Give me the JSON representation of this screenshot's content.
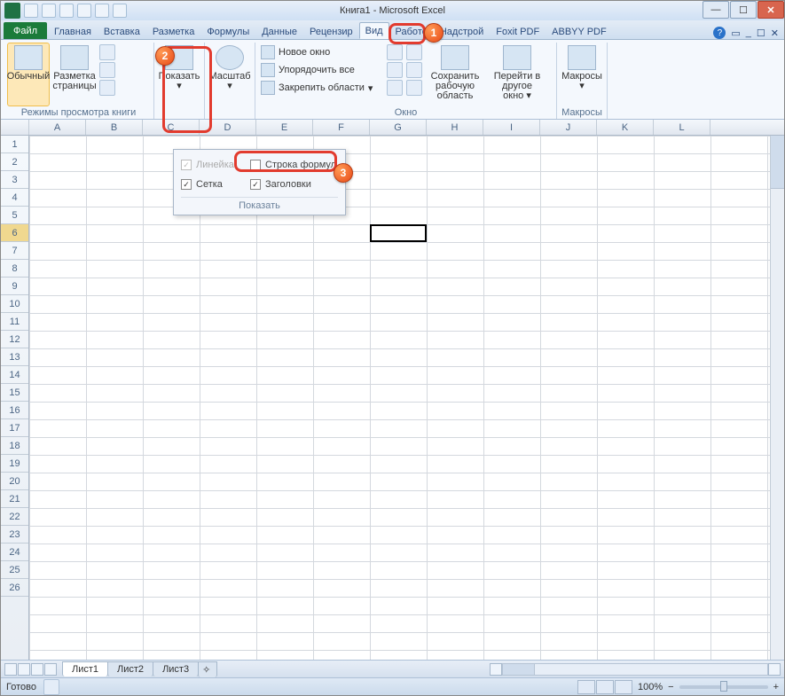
{
  "window": {
    "title": "Книга1 - Microsoft Excel"
  },
  "tabs": {
    "file": "Файл",
    "items": [
      "Главная",
      "Вставка",
      "Разметка",
      "Формулы",
      "Данные",
      "Рецензир",
      "Вид",
      "Работо",
      "Надстрой",
      "Foxit PDF",
      "ABBYY PDF"
    ],
    "activeIndex": 6
  },
  "ribbon": {
    "views_group_label": "Режимы просмотра книги",
    "normal": "Обычный",
    "page_layout": "Разметка страницы",
    "show_btn": "Показать",
    "zoom_btn": "Масштаб",
    "new_window": "Новое окно",
    "arrange_all": "Упорядочить все",
    "freeze_panes": "Закрепить области",
    "save_workspace": "Сохранить рабочую область",
    "switch_windows": "Перейти в другое окно",
    "window_group_label": "Окно",
    "macros": "Макросы",
    "macros_group_label": "Макросы"
  },
  "show_panel": {
    "ruler": "Линейка",
    "formula_bar": "Строка формул",
    "gridlines": "Сетка",
    "headings": "Заголовки",
    "label": "Показать",
    "ruler_checked": false,
    "formula_checked": false,
    "gridlines_checked": true,
    "headings_checked": true
  },
  "columns": [
    "A",
    "B",
    "C",
    "D",
    "E",
    "F",
    "G",
    "H",
    "I",
    "J",
    "K",
    "L"
  ],
  "rows": [
    "1",
    "2",
    "3",
    "4",
    "5",
    "6",
    "7",
    "8",
    "9",
    "10",
    "11",
    "12",
    "13",
    "14",
    "15",
    "16",
    "17",
    "18",
    "19",
    "20",
    "21",
    "22",
    "23",
    "24",
    "25",
    "26"
  ],
  "highlighted_row": "6",
  "selected_cell": {
    "col_index": 6,
    "row_index": 5
  },
  "sheets": {
    "items": [
      "Лист1",
      "Лист2",
      "Лист3"
    ],
    "activeIndex": 0
  },
  "status": {
    "ready": "Готово",
    "zoom": "100%"
  },
  "badges": {
    "b1": "1",
    "b2": "2",
    "b3": "3"
  }
}
